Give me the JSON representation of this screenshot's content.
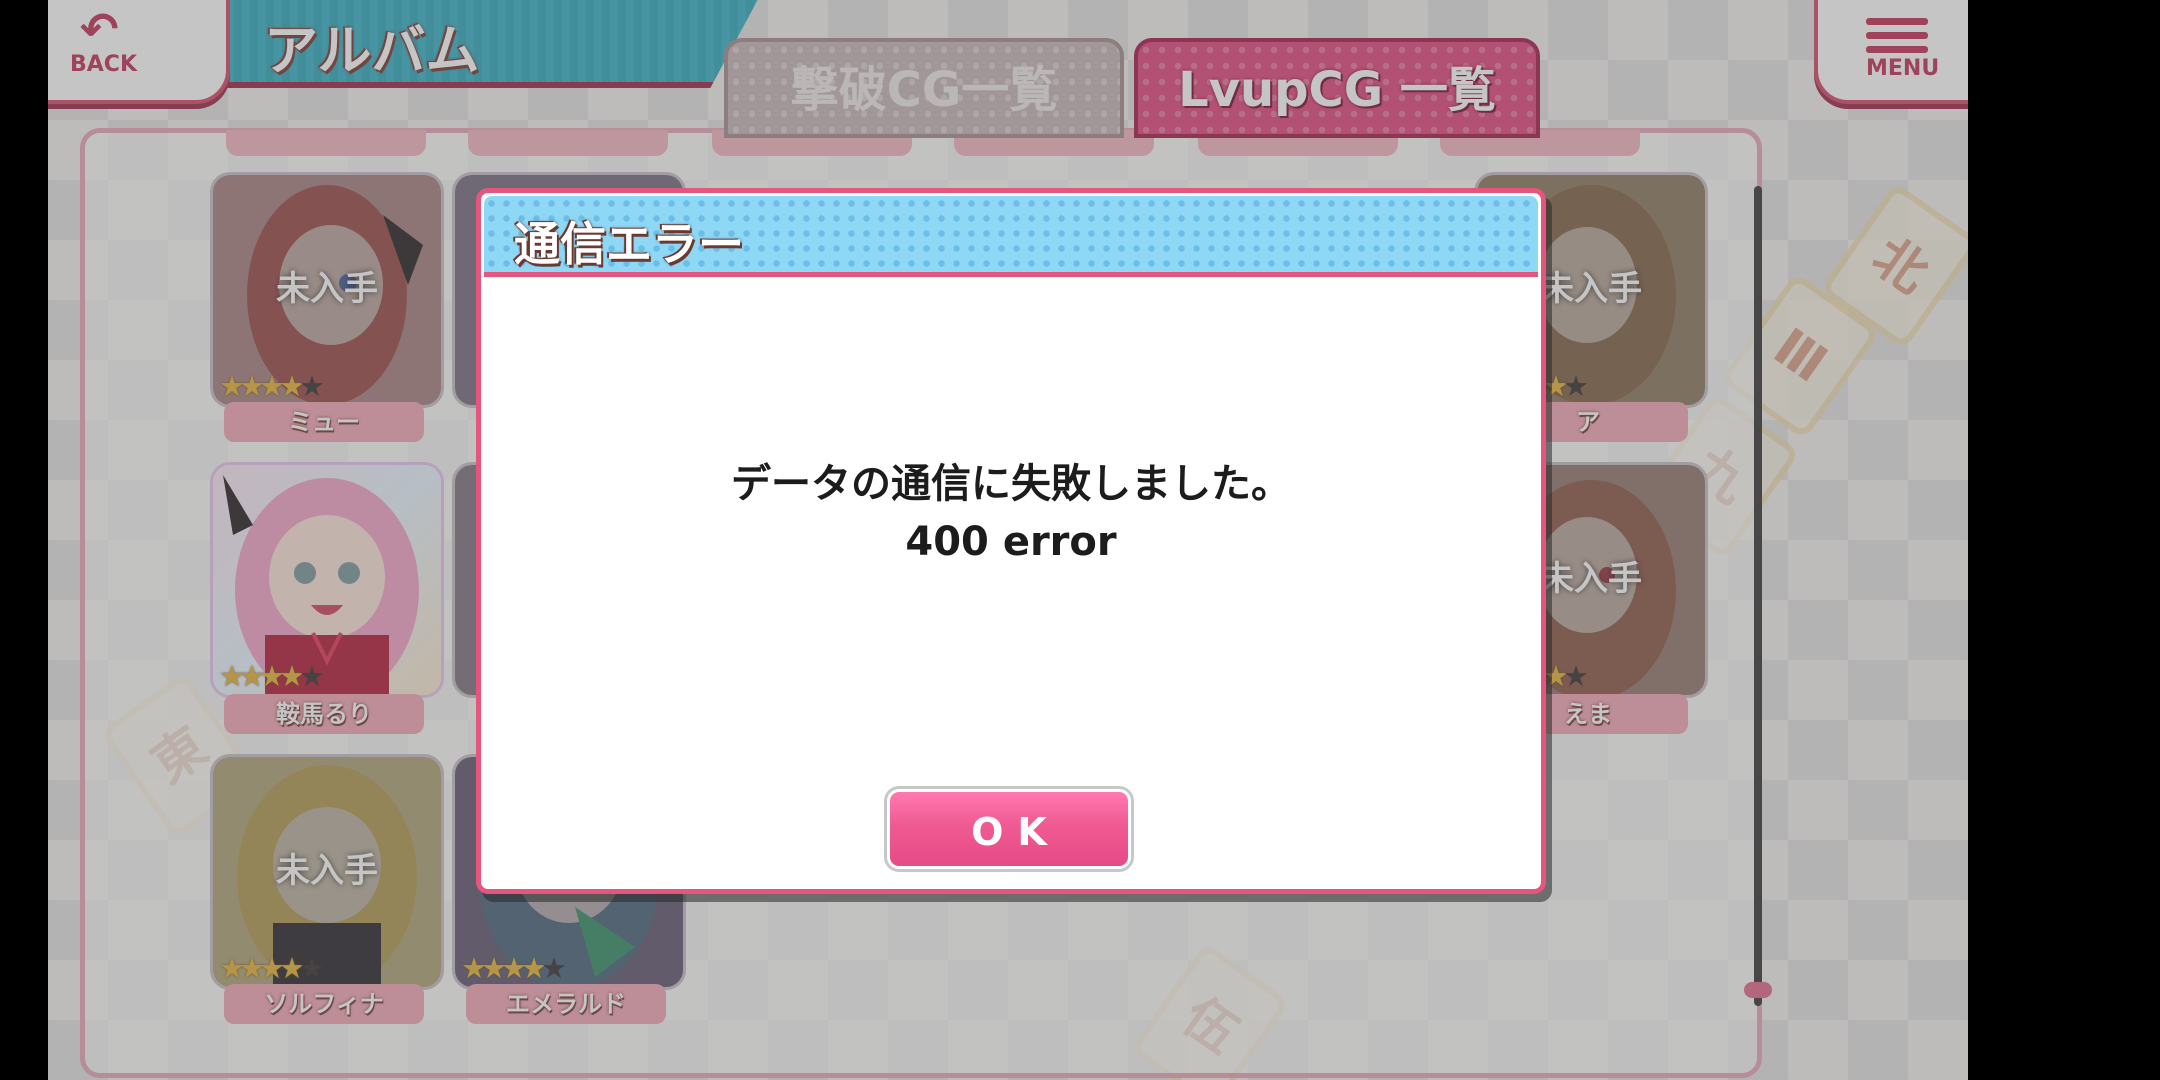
{
  "header": {
    "back_label": "BACK",
    "title": "アルバム",
    "menu_label": "MENU"
  },
  "tabs": [
    {
      "label": "撃破CG一覧",
      "active": false
    },
    {
      "label": "LvupCG 一覧",
      "active": true
    }
  ],
  "album": {
    "unobtained_label": "未入手",
    "cards": [
      {
        "name": "ミュー",
        "obtained": false,
        "stars": 4,
        "max_stars": 5
      },
      {
        "name": "鞍馬るり",
        "obtained": true,
        "stars": 4,
        "max_stars": 5
      },
      {
        "name": "ソルフィナ",
        "obtained": false,
        "stars": 4,
        "max_stars": 5
      },
      {
        "name": "エメラルド",
        "obtained": false,
        "stars": 4,
        "max_stars": 5
      },
      {
        "name": "ア",
        "obtained": false,
        "stars": 4,
        "max_stars": 5
      },
      {
        "name": "えま",
        "obtained": false,
        "stars": 4,
        "max_stars": 5
      }
    ]
  },
  "dialog": {
    "title": "通信エラー",
    "message_line1": "データの通信に失敗しました。",
    "message_line2": "400 error",
    "ok_label": "OK"
  },
  "colors": {
    "accent_pink": "#e14a80",
    "dialog_header": "#8ed8f6",
    "banner_teal": "#3bb4c9"
  }
}
